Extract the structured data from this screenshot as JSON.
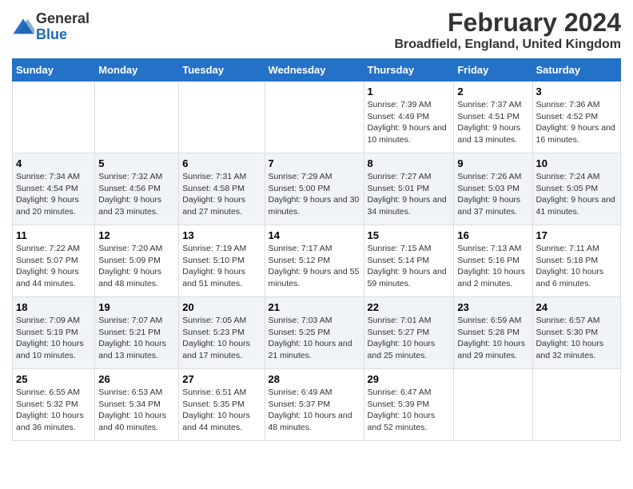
{
  "header": {
    "logo_line1": "General",
    "logo_line2": "Blue",
    "title": "February 2024",
    "subtitle": "Broadfield, England, United Kingdom"
  },
  "days_of_week": [
    "Sunday",
    "Monday",
    "Tuesday",
    "Wednesday",
    "Thursday",
    "Friday",
    "Saturday"
  ],
  "weeks": [
    [
      {
        "day": "",
        "info": ""
      },
      {
        "day": "",
        "info": ""
      },
      {
        "day": "",
        "info": ""
      },
      {
        "day": "",
        "info": ""
      },
      {
        "day": "1",
        "info": "Sunrise: 7:39 AM\nSunset: 4:49 PM\nDaylight: 9 hours\nand 10 minutes."
      },
      {
        "day": "2",
        "info": "Sunrise: 7:37 AM\nSunset: 4:51 PM\nDaylight: 9 hours\nand 13 minutes."
      },
      {
        "day": "3",
        "info": "Sunrise: 7:36 AM\nSunset: 4:52 PM\nDaylight: 9 hours\nand 16 minutes."
      }
    ],
    [
      {
        "day": "4",
        "info": "Sunrise: 7:34 AM\nSunset: 4:54 PM\nDaylight: 9 hours\nand 20 minutes."
      },
      {
        "day": "5",
        "info": "Sunrise: 7:32 AM\nSunset: 4:56 PM\nDaylight: 9 hours\nand 23 minutes."
      },
      {
        "day": "6",
        "info": "Sunrise: 7:31 AM\nSunset: 4:58 PM\nDaylight: 9 hours\nand 27 minutes."
      },
      {
        "day": "7",
        "info": "Sunrise: 7:29 AM\nSunset: 5:00 PM\nDaylight: 9 hours\nand 30 minutes."
      },
      {
        "day": "8",
        "info": "Sunrise: 7:27 AM\nSunset: 5:01 PM\nDaylight: 9 hours\nand 34 minutes."
      },
      {
        "day": "9",
        "info": "Sunrise: 7:26 AM\nSunset: 5:03 PM\nDaylight: 9 hours\nand 37 minutes."
      },
      {
        "day": "10",
        "info": "Sunrise: 7:24 AM\nSunset: 5:05 PM\nDaylight: 9 hours\nand 41 minutes."
      }
    ],
    [
      {
        "day": "11",
        "info": "Sunrise: 7:22 AM\nSunset: 5:07 PM\nDaylight: 9 hours\nand 44 minutes."
      },
      {
        "day": "12",
        "info": "Sunrise: 7:20 AM\nSunset: 5:09 PM\nDaylight: 9 hours\nand 48 minutes."
      },
      {
        "day": "13",
        "info": "Sunrise: 7:19 AM\nSunset: 5:10 PM\nDaylight: 9 hours\nand 51 minutes."
      },
      {
        "day": "14",
        "info": "Sunrise: 7:17 AM\nSunset: 5:12 PM\nDaylight: 9 hours\nand 55 minutes."
      },
      {
        "day": "15",
        "info": "Sunrise: 7:15 AM\nSunset: 5:14 PM\nDaylight: 9 hours\nand 59 minutes."
      },
      {
        "day": "16",
        "info": "Sunrise: 7:13 AM\nSunset: 5:16 PM\nDaylight: 10 hours\nand 2 minutes."
      },
      {
        "day": "17",
        "info": "Sunrise: 7:11 AM\nSunset: 5:18 PM\nDaylight: 10 hours\nand 6 minutes."
      }
    ],
    [
      {
        "day": "18",
        "info": "Sunrise: 7:09 AM\nSunset: 5:19 PM\nDaylight: 10 hours\nand 10 minutes."
      },
      {
        "day": "19",
        "info": "Sunrise: 7:07 AM\nSunset: 5:21 PM\nDaylight: 10 hours\nand 13 minutes."
      },
      {
        "day": "20",
        "info": "Sunrise: 7:05 AM\nSunset: 5:23 PM\nDaylight: 10 hours\nand 17 minutes."
      },
      {
        "day": "21",
        "info": "Sunrise: 7:03 AM\nSunset: 5:25 PM\nDaylight: 10 hours\nand 21 minutes."
      },
      {
        "day": "22",
        "info": "Sunrise: 7:01 AM\nSunset: 5:27 PM\nDaylight: 10 hours\nand 25 minutes."
      },
      {
        "day": "23",
        "info": "Sunrise: 6:59 AM\nSunset: 5:28 PM\nDaylight: 10 hours\nand 29 minutes."
      },
      {
        "day": "24",
        "info": "Sunrise: 6:57 AM\nSunset: 5:30 PM\nDaylight: 10 hours\nand 32 minutes."
      }
    ],
    [
      {
        "day": "25",
        "info": "Sunrise: 6:55 AM\nSunset: 5:32 PM\nDaylight: 10 hours\nand 36 minutes."
      },
      {
        "day": "26",
        "info": "Sunrise: 6:53 AM\nSunset: 5:34 PM\nDaylight: 10 hours\nand 40 minutes."
      },
      {
        "day": "27",
        "info": "Sunrise: 6:51 AM\nSunset: 5:35 PM\nDaylight: 10 hours\nand 44 minutes."
      },
      {
        "day": "28",
        "info": "Sunrise: 6:49 AM\nSunset: 5:37 PM\nDaylight: 10 hours\nand 48 minutes."
      },
      {
        "day": "29",
        "info": "Sunrise: 6:47 AM\nSunset: 5:39 PM\nDaylight: 10 hours\nand 52 minutes."
      },
      {
        "day": "",
        "info": ""
      },
      {
        "day": "",
        "info": ""
      }
    ]
  ]
}
